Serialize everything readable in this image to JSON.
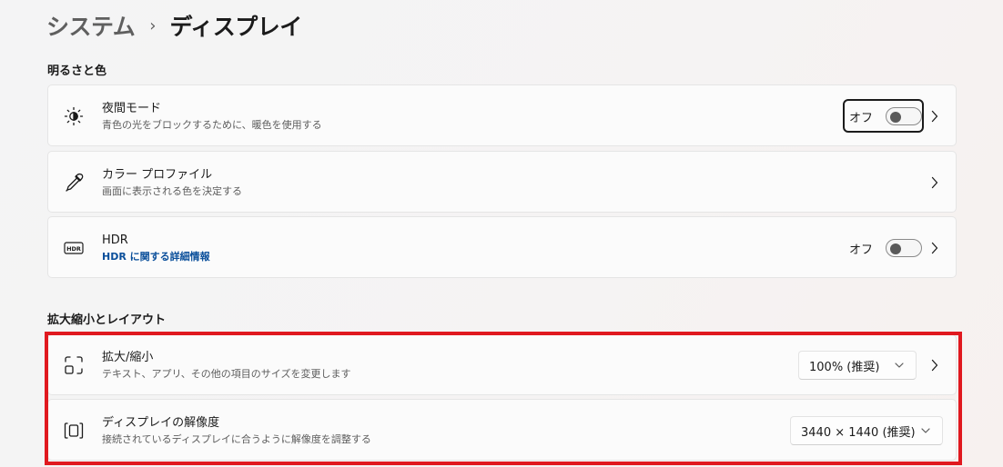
{
  "breadcrumb": {
    "parent": "システム",
    "separator": "›",
    "current": "ディスプレイ"
  },
  "sections": {
    "brightness": {
      "title": "明るさと色"
    },
    "scale": {
      "title": "拡大縮小とレイアウト"
    }
  },
  "night_light": {
    "icon": "brightness-icon",
    "title": "夜間モード",
    "desc": "青色の光をブロックするために、暖色を使用する",
    "toggle_label": "オフ",
    "toggle_on": false
  },
  "color_profile": {
    "icon": "eyedropper-icon",
    "title": "カラー プロファイル",
    "desc": "画面に表示される色を決定する"
  },
  "hdr": {
    "icon": "hdr-icon",
    "icon_text": "HDR",
    "title": "HDR",
    "link": "HDR に関する詳細情報",
    "toggle_label": "オフ",
    "toggle_on": false
  },
  "scale": {
    "icon": "scale-icon",
    "title": "拡大/縮小",
    "desc": "テキスト、アプリ、その他の項目のサイズを変更します",
    "selected": "100% (推奨)"
  },
  "resolution": {
    "icon": "resolution-icon",
    "title": "ディスプレイの解像度",
    "desc": "接続されているディスプレイに合うように解像度を調整する",
    "selected": "3440 × 1440 (推奨)"
  },
  "colors": {
    "accent_link": "#0a4f9b",
    "highlight": "#e0191f"
  }
}
